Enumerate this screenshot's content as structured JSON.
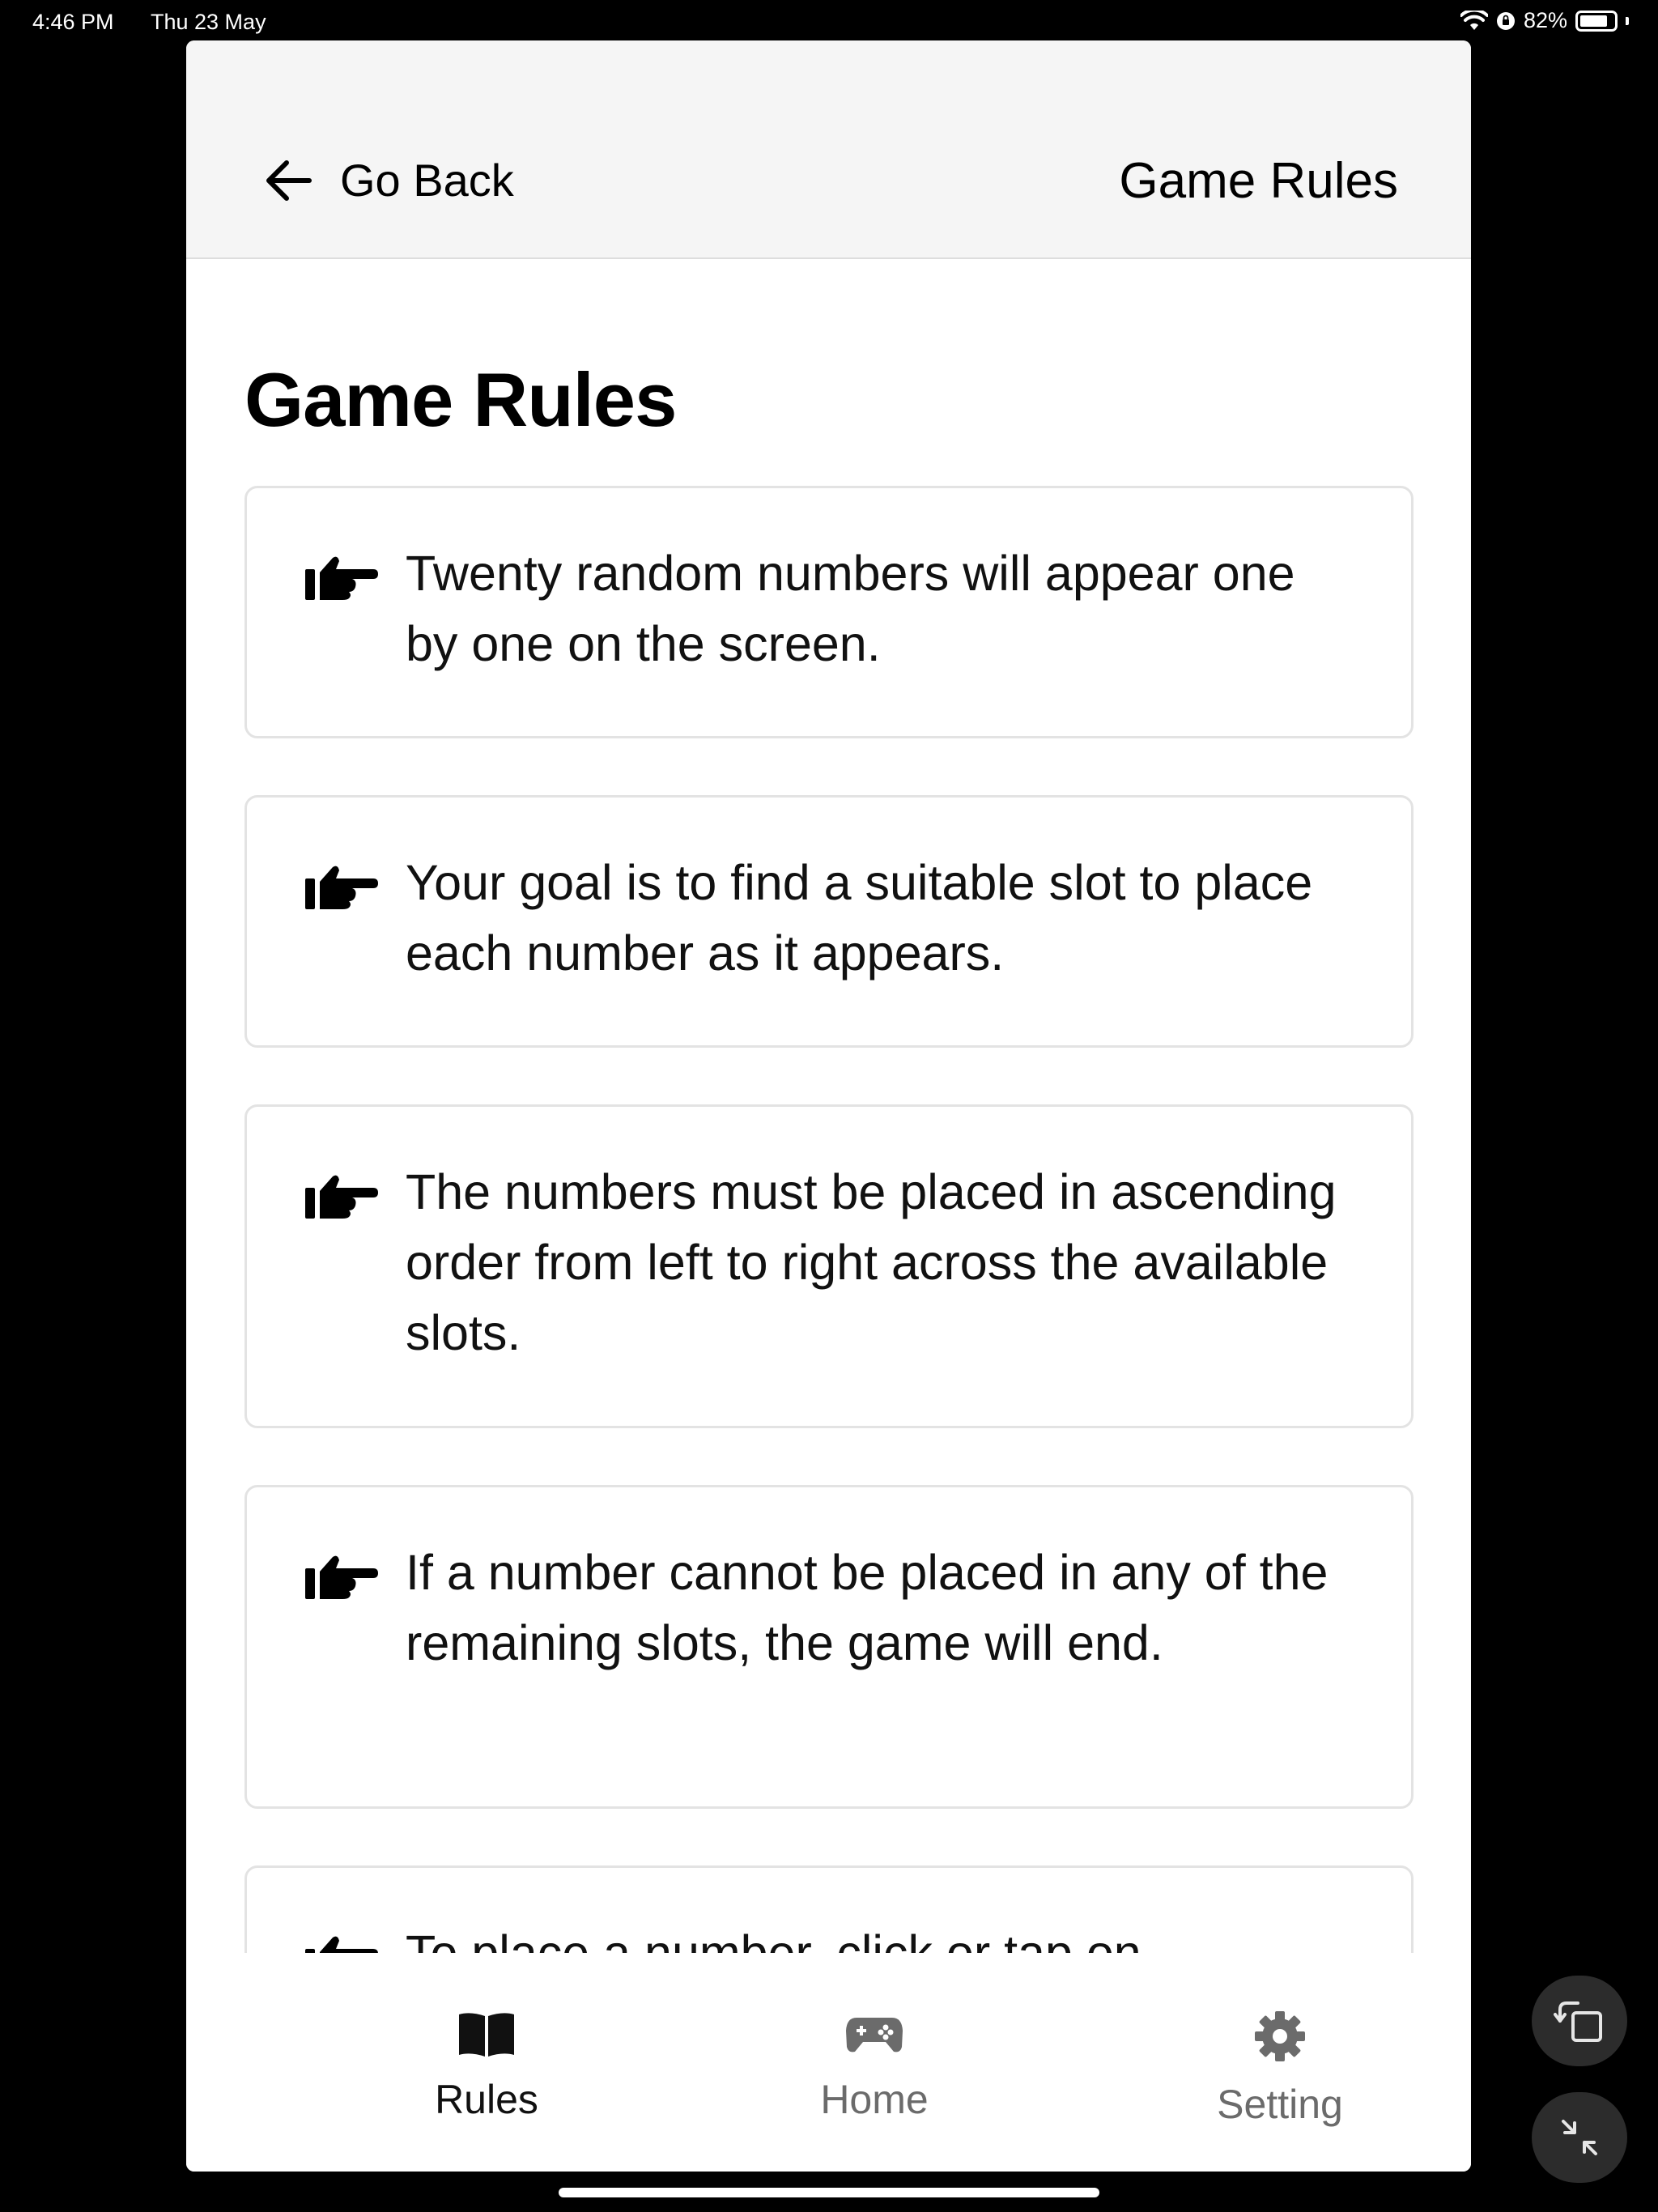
{
  "status_bar": {
    "time": "4:46 PM",
    "date": "Thu 23 May",
    "battery": "82%",
    "battery_level": 0.82
  },
  "header": {
    "back_label": "Go Back",
    "title": "Game Rules"
  },
  "page": {
    "title": "Game Rules"
  },
  "rules": [
    "Twenty random numbers will appear one by one on the screen.",
    "Your goal is to find a suitable slot to place each number as it appears.",
    "The numbers must be placed in ascending order from left to right across the available slots.",
    "If a number cannot be placed in any of the remaining slots, the game will end.",
    "To place a number, click or tap on"
  ],
  "tabs": [
    {
      "label": "Rules",
      "icon": "book-open-icon",
      "active": true
    },
    {
      "label": "Home",
      "icon": "gamepad-icon",
      "active": false
    },
    {
      "label": "Setting",
      "icon": "gear-icon",
      "active": false
    }
  ],
  "floating_buttons": [
    "rotate-screen-icon",
    "minimize-icon"
  ],
  "colors": {
    "header_bg": "#f5f5f5",
    "active_tab": "#111111",
    "inactive_tab": "#6b6b6b",
    "card_border": "#e3e3e3"
  }
}
